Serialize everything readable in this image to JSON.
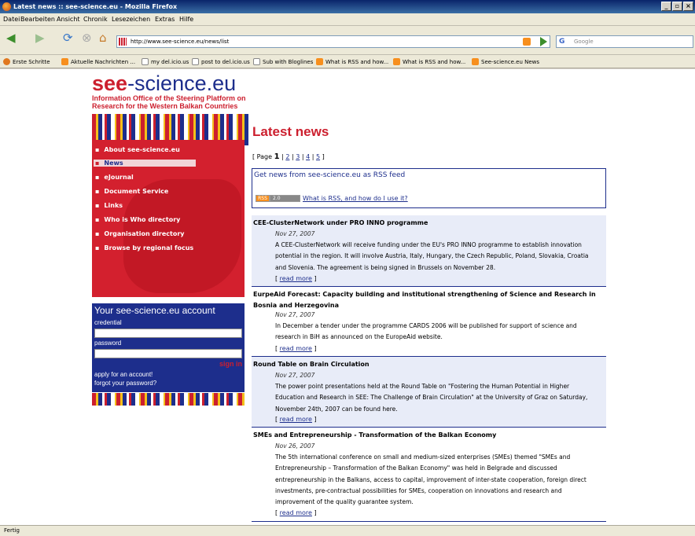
{
  "window": {
    "title": "Latest news :: see-science.eu - Mozilla Firefox",
    "buttons": [
      "_",
      "▫",
      "×"
    ]
  },
  "menu": [
    "Datei",
    "Bearbeiten",
    "Ansicht",
    "Chronik",
    "Lesezeichen",
    "Extras",
    "Hilfe"
  ],
  "navbar": {
    "url": "http://www.see-science.eu/news/list",
    "search_placeholder": "Google"
  },
  "bookmarks": [
    {
      "label": "Erste Schritte",
      "icon": "firefox-icon"
    },
    {
      "label": "Aktuelle Nachrichten ...",
      "icon": "rss-icon"
    },
    {
      "label": "my del.icio.us",
      "icon": "page-icon"
    },
    {
      "label": "post to del.icio.us",
      "icon": "page-icon"
    },
    {
      "label": "Sub with Bloglines",
      "icon": "page-icon"
    },
    {
      "label": "What is RSS and how...",
      "icon": "rss-icon"
    },
    {
      "label": "What is RSS and how...",
      "icon": "rss-icon"
    },
    {
      "label": "See-science.eu News",
      "icon": "rss-icon"
    }
  ],
  "status": "Fertig",
  "logo": {
    "brand_bold": "see",
    "brand_rest": "-science.eu",
    "sub1": "Information Office of the Steering Platform on",
    "sub2": "Research for the Western Balkan Countries"
  },
  "sidebar": {
    "items": [
      {
        "label": "About see-science.eu"
      },
      {
        "label": "News"
      },
      {
        "label": "eJournal"
      },
      {
        "label": "Document Service"
      },
      {
        "label": "Links"
      },
      {
        "label": "Who is Who directory"
      },
      {
        "label": "Organisation directory"
      },
      {
        "label": "Browse by regional focus"
      }
    ]
  },
  "account": {
    "heading": "Your see-science.eu account",
    "credential_label": "credential",
    "password_label": "password",
    "signin": "sign in",
    "apply": "apply for an account!",
    "forgot": "forgot your password?"
  },
  "main": {
    "heading": "Latest news",
    "pager": {
      "open": "[ Page ",
      "current": "1",
      "pages": [
        "2",
        "3",
        "4",
        "5"
      ],
      "close": " ]"
    },
    "rss": {
      "title": "Get news from see-science.eu as RSS feed",
      "badge_a": "RSS",
      "badge_b": "2.0",
      "question": "What is RSS, and how do I use it?"
    },
    "read_more": "read more",
    "news": [
      {
        "title": "CEE-ClusterNetwork under PRO INNO programme",
        "date": "Nov 27, 2007",
        "lines": [
          "A CEE-ClusterNetwork will receive funding under the EU's PRO INNO programme to establish innovation",
          "potential in the region. It will involve Austria, Italy, Hungary, the Czech Republic, Poland, Slovakia, Croatia",
          "and Slovenia. The agreement is being signed in Brussels on November 28."
        ]
      },
      {
        "title": "EurpeAid Forecast: Capacity building and institutional strengthening of Science and Research in Bosnia and Herzegovina",
        "date": "Nov 27, 2007",
        "lines": [
          "In December a tender under the programme CARDS 2006 will be published for support of science and",
          "research in BiH as announced on the EuropeAid website."
        ]
      },
      {
        "title": "Round Table on Brain Circulation",
        "date": "Nov 27, 2007",
        "lines": [
          "The power point presentations held at the Round Table on \"Fostering the Human Potential in Higher",
          "Education and Research in SEE: The Challenge of Brain Circulation\" at the University of Graz on Saturday,",
          "November 24th, 2007 can be found here."
        ]
      },
      {
        "title": "SMEs and Entrepreneurship - Transformation of the Balkan Economy",
        "date": "Nov 26, 2007",
        "lines": [
          "The 5th international conference on small and medium-sized enterprises (SMEs) themed \"SMEs and",
          "Entrepreneurship – Transformation of the Balkan Economy\" was held in Belgrade and discussed",
          "entrepreneurship in the Balkans, access to capital, improvement of inter-state cooperation, foreign direct",
          "investments, pre-contractual possibilities for SMEs, cooperation on innovations and research and",
          "improvement of the quality guarantee system."
        ]
      }
    ]
  }
}
